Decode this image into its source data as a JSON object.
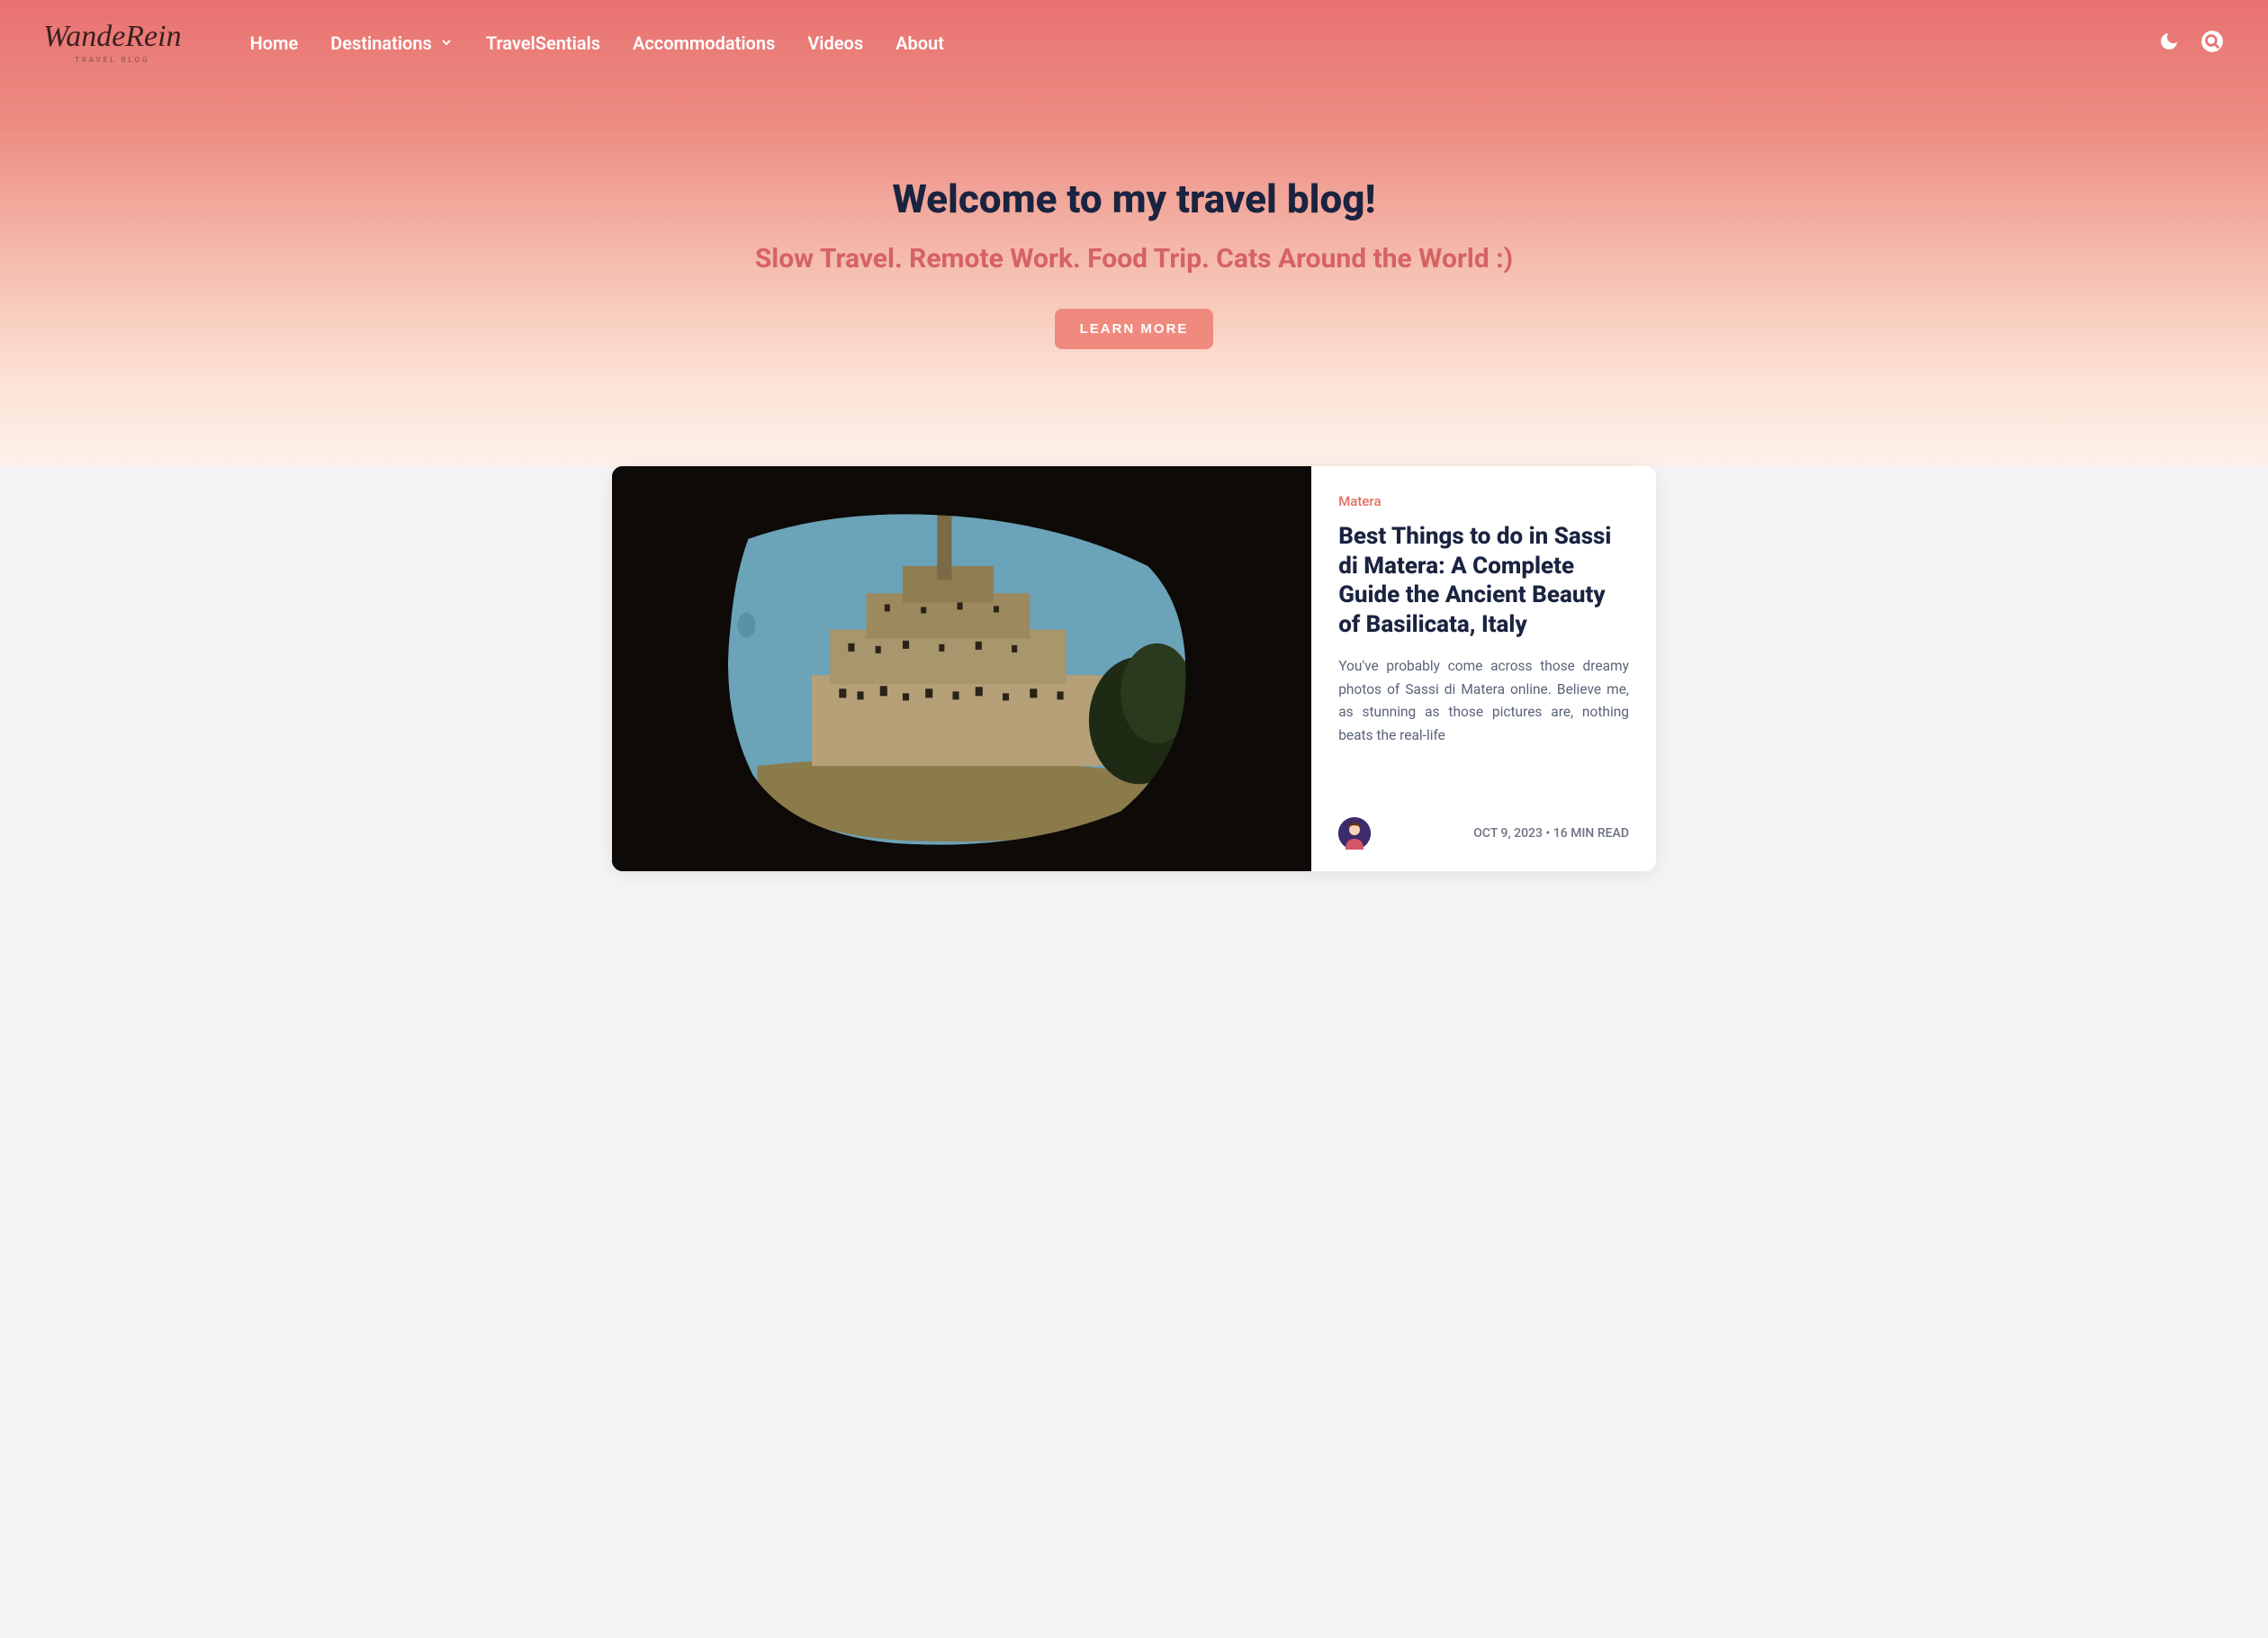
{
  "logo": {
    "main": "WandeRein",
    "sub": "TRAVEL BLOG"
  },
  "nav": {
    "home": "Home",
    "destinations": "Destinations",
    "travelsentials": "TravelSentials",
    "accommodations": "Accommodations",
    "videos": "Videos",
    "about": "About"
  },
  "hero": {
    "title": "Welcome to my travel blog!",
    "subtitle": "Slow Travel. Remote Work. Food Trip. Cats Around the World :)",
    "cta": "LEARN MORE"
  },
  "post": {
    "tag": "Matera",
    "title": "Best Things to do in Sassi di Matera: A Complete Guide the Ancient Beauty of Basilicata, Italy",
    "excerpt": "You've probably come across those dreamy photos of Sassi di Matera online. Believe me, as stunning as those pictures are, nothing beats the real-life",
    "date": "OCT 9, 2023",
    "sep": " • ",
    "read": "16 MIN READ"
  }
}
